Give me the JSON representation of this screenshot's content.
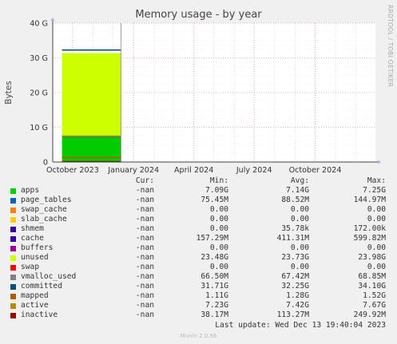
{
  "title": "Memory usage - by year",
  "side_label": "RRDTOOL / TOBI OETIKER",
  "last_update": "Last update: Wed Dec 13 19:40:04 2023",
  "footer": "Munin 2.0.56",
  "legend_headers": {
    "cur": "Cur:",
    "min": "Min:",
    "avg": "Avg:",
    "max": "Max:"
  },
  "legend": [
    {
      "name": "apps",
      "color": "#00cc00",
      "cur": "-nan",
      "min": "7.09G",
      "avg": "7.14G",
      "max": "7.25G"
    },
    {
      "name": "page_tables",
      "color": "#0066b3",
      "cur": "-nan",
      "min": "75.45M",
      "avg": "88.52M",
      "max": "144.97M"
    },
    {
      "name": "swap_cache",
      "color": "#ff8000",
      "cur": "-nan",
      "min": "0.00",
      "avg": "0.00",
      "max": "0.00"
    },
    {
      "name": "slab_cache",
      "color": "#ffcc00",
      "cur": "-nan",
      "min": "0.00",
      "avg": "0.00",
      "max": "0.00"
    },
    {
      "name": "shmem",
      "color": "#330099",
      "cur": "-nan",
      "min": "0.00",
      "avg": "35.78k",
      "max": "172.00k"
    },
    {
      "name": "cache",
      "color": "#330099",
      "cur": "-nan",
      "min": "157.29M",
      "avg": "411.31M",
      "max": "599.82M"
    },
    {
      "name": "buffers",
      "color": "#990099",
      "cur": "-nan",
      "min": "0.00",
      "avg": "0.00",
      "max": "0.00"
    },
    {
      "name": "unused",
      "color": "#ccff00",
      "cur": "-nan",
      "min": "23.48G",
      "avg": "23.73G",
      "max": "23.98G"
    },
    {
      "name": "swap",
      "color": "#ff0000",
      "cur": "-nan",
      "min": "0.00",
      "avg": "0.00",
      "max": "0.00"
    },
    {
      "name": "vmalloc_used",
      "color": "#808080",
      "cur": "-nan",
      "min": "66.50M",
      "avg": "67.42M",
      "max": "68.85M"
    },
    {
      "name": "committed",
      "color": "#004d80",
      "cur": "-nan",
      "min": "31.71G",
      "avg": "32.25G",
      "max": "34.10G"
    },
    {
      "name": "mapped",
      "color": "#b35a00",
      "cur": "-nan",
      "min": "1.11G",
      "avg": "1.28G",
      "max": "1.52G"
    },
    {
      "name": "active",
      "color": "#b38f00",
      "cur": "-nan",
      "min": "7.23G",
      "avg": "7.42G",
      "max": "7.67G"
    },
    {
      "name": "inactive",
      "color": "#990000",
      "cur": "-nan",
      "min": "38.17M",
      "avg": "113.27M",
      "max": "249.92M"
    }
  ],
  "chart_data": {
    "type": "area",
    "ylabel": "Bytes",
    "ylim": [
      0,
      40
    ],
    "y_unit": "G",
    "yticks": [
      0,
      10,
      20,
      30,
      40
    ],
    "ytick_labels": [
      "0",
      "10 G",
      "20 G",
      "30 G",
      "40 G"
    ],
    "x_range": [
      "2023-09-01",
      "2024-12-31"
    ],
    "xticks": [
      "2023-10-01",
      "2024-01-01",
      "2024-04-01",
      "2024-07-01",
      "2024-10-01"
    ],
    "xtick_labels": [
      "October 2023",
      "January 2024",
      "April 2024",
      "July 2024",
      "October 2024"
    ],
    "grid": true,
    "data_range": [
      "2023-09-15",
      "2023-12-13"
    ],
    "stack": [
      {
        "name": "apps",
        "value": 7.14,
        "color": "#00cc00"
      },
      {
        "name": "page_tables",
        "value": 0.09,
        "color": "#0066b3"
      },
      {
        "name": "cache",
        "value": 0.41,
        "color": "#330099"
      },
      {
        "name": "unused",
        "value": 23.73,
        "color": "#ccff00"
      }
    ],
    "lines": [
      {
        "name": "committed",
        "value": 32.25,
        "color": "#004d80"
      },
      {
        "name": "mapped",
        "value": 1.28,
        "color": "#b35a00"
      },
      {
        "name": "active",
        "value": 7.42,
        "color": "#b38f00"
      },
      {
        "name": "inactive",
        "value": 0.11,
        "color": "#990000"
      }
    ]
  }
}
